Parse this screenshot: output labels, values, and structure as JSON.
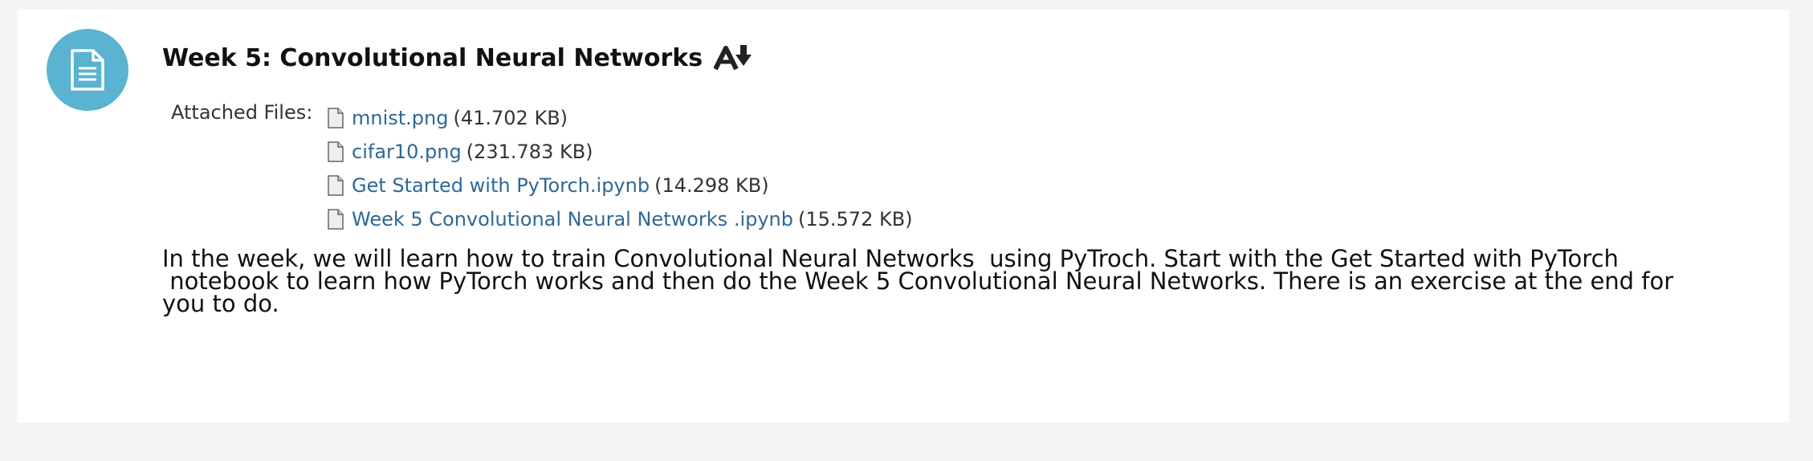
{
  "item": {
    "icon": "document-icon",
    "title": "Week 5: Convolutional Neural Networks",
    "adaptive_release_icon": "adaptive-release-icon"
  },
  "attachments": {
    "label": "Attached Files:",
    "files": [
      {
        "name": "mnist.png",
        "size": "(41.702 KB)",
        "icon": "file-icon"
      },
      {
        "name": "cifar10.png",
        "size": "(231.783 KB)",
        "icon": "file-icon"
      },
      {
        "name": "Get Started with PyTorch.ipynb",
        "size": "(14.298 KB)",
        "icon": "file-icon"
      },
      {
        "name": "Week 5 Convolutional Neural Networks .ipynb",
        "size": "(15.572 KB)",
        "icon": "file-icon"
      }
    ]
  },
  "description": "In the week, we will learn how to train Convolutional Neural Networks  using PyTroch. Start with the Get Started with PyTorch\n notebook to learn how PyTorch works and then do the Week 5 Convolutional Neural Networks. There is an exercise at the end for\nyou to do.",
  "colors": {
    "page_background": "#f5f5f5",
    "card_background": "#ffffff",
    "icon_circle": "#5ab3d0",
    "link": "#2f6797",
    "text": "#111111"
  }
}
